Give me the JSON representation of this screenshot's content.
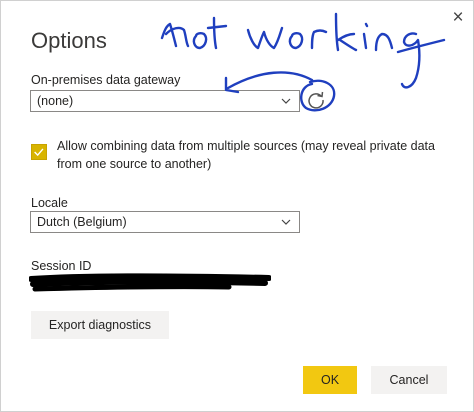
{
  "dialog": {
    "title": "Options",
    "close_glyph": "×"
  },
  "gateway": {
    "label": "On-premises data gateway",
    "selected": "(none)",
    "refresh_icon": "refresh-icon"
  },
  "combine": {
    "checked": true,
    "label": "Allow combining data from multiple sources (may reveal private data from one source to another)"
  },
  "locale": {
    "label": "Locale",
    "selected": "Dutch (Belgium)"
  },
  "session": {
    "label": "Session ID"
  },
  "buttons": {
    "export": "Export diagnostics",
    "ok": "OK",
    "cancel": "Cancel"
  },
  "annotation": {
    "text": "not working"
  },
  "colors": {
    "accent": "#f2c811",
    "checkbox": "#d8b400",
    "ink": "#1f3fbf",
    "redaction": "#000000"
  }
}
